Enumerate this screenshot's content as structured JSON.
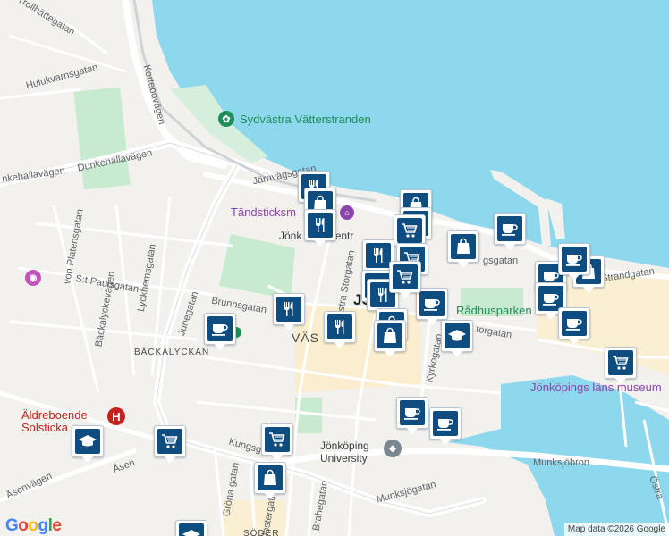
{
  "map": {
    "streets": {
      "trollhattegatan": "Trollhättegatan",
      "hulukvarnsgatan": "Hulukvarnsgatan",
      "kortebovagen": "Kortebovägen",
      "dunkehallavagen": "Dunkehallavägen",
      "dunkehallavagen_w": "nkehallavägen",
      "jarnvagsgatan": "Järnvägsgatan",
      "von_platensgatan": "von Platensgatan",
      "st_paulsgatan": "S:t Paulsgatan",
      "lyckhemsgatan": "Lyckhemsgatan",
      "backalyckevagen": "Bäckalyckevägen",
      "brunnsgatan": "Brunnsgatan",
      "junegatan": "Junegatan",
      "vastra_storgatan": "Västra Storgatan",
      "kyrkogatan": "Kyrkogatan",
      "kungsgatan": "Kungsgatan",
      "gronagatan": "Gröna gatan",
      "klostergatan": "Klostergatan",
      "brahegatan": "Brahegatan",
      "munksjogatan": "Munksjögatan",
      "munksjobron": "Munksjöbron",
      "asenvagen": "Åsenvägen",
      "asen": "Åsen",
      "ostra": "Östra",
      "strandgatan": "Strandgatan",
      "hamngatan": "gsgatan",
      "ostra_storgatan": "torgatan"
    },
    "places": {
      "sydvastra": "Sydvästra Vätterstranden",
      "tandsticks": "Tändsticksm",
      "resecentrum": "Jönk      Resecentr",
      "jonkoping_short": "Jö",
      "vast": "VÄS",
      "backalyckan": "BÄCKALYCKAN",
      "radhusparken": "Rådhusparken",
      "lans_museum": "Jönköpings läns museum",
      "university": "Jönköping\nUniversity",
      "aldreboende": "Äldreboende\nSolsticka",
      "soder": "SÖDER"
    },
    "attribution": "Map data ©2026 Google",
    "logo": "Google",
    "colors": {
      "water": "#8dd8ec",
      "land": "#f3f1ee",
      "park": "#c8ebd0",
      "marker": "#0f4d80",
      "highlight": "#fbeec7"
    },
    "markers": [
      {
        "icon": "restaurant"
      },
      {
        "icon": "shopping-bag"
      },
      {
        "icon": "restaurant"
      },
      {
        "icon": "shopping-bag"
      },
      {
        "icon": "shopping-cart"
      },
      {
        "icon": "shopping-cart"
      },
      {
        "icon": "cafe"
      },
      {
        "icon": "shopping-bag"
      },
      {
        "icon": "restaurant"
      },
      {
        "icon": "shopping-cart"
      },
      {
        "icon": "restaurant"
      },
      {
        "icon": "restaurant"
      },
      {
        "icon": "cafe"
      },
      {
        "icon": "cafe"
      },
      {
        "icon": "shopping-bag"
      },
      {
        "icon": "cafe"
      },
      {
        "icon": "shopping-bag"
      },
      {
        "icon": "cafe"
      },
      {
        "icon": "restaurant"
      },
      {
        "icon": "restaurant"
      },
      {
        "icon": "cafe"
      },
      {
        "icon": "shopping-bag"
      },
      {
        "icon": "graduation-cap"
      },
      {
        "icon": "shopping-cart"
      },
      {
        "icon": "cafe"
      },
      {
        "icon": "cafe"
      },
      {
        "icon": "shopping-cart"
      },
      {
        "icon": "shopping-cart"
      },
      {
        "icon": "graduation-cap"
      },
      {
        "icon": "shopping-bag"
      },
      {
        "icon": "cafe"
      },
      {
        "icon": "shopping-cart"
      },
      {
        "icon": "graduation-cap"
      }
    ]
  }
}
